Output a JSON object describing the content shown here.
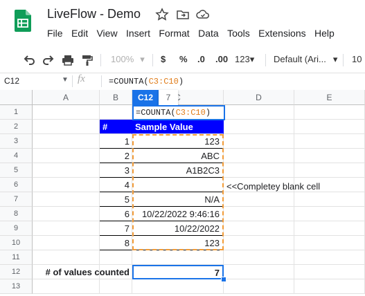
{
  "doc": {
    "title": "LiveFlow - Demo"
  },
  "menu": [
    "File",
    "Edit",
    "View",
    "Insert",
    "Format",
    "Data",
    "Tools",
    "Extensions",
    "Help"
  ],
  "toolbar": {
    "zoom": "100%",
    "currency": "$",
    "percent": "%",
    "dec_less": ".0",
    "dec_more": ".00",
    "more_formats": "123",
    "font": "Default (Ari...",
    "font_size": "10"
  },
  "formula_bar": {
    "cell_ref": "C12",
    "fx": "fx",
    "formula_prefix": "=COUNTA(",
    "formula_ref": "C3:C10",
    "formula_suffix": ")"
  },
  "columns": [
    "A",
    "B",
    "C",
    "D",
    "E"
  ],
  "rows": [
    "1",
    "2",
    "3",
    "4",
    "5",
    "6",
    "7",
    "8",
    "9",
    "10",
    "11",
    "12",
    "13"
  ],
  "table": {
    "header_num": "#",
    "header_value": "Sample Value",
    "nums": [
      "1",
      "2",
      "3",
      "4",
      "5",
      "6",
      "7",
      "8"
    ],
    "values": [
      "123",
      "ABC",
      "A1B2C3",
      "",
      "N/A",
      "10/22/2022 9:46:16",
      "10/22/2022",
      "123"
    ]
  },
  "annotation": "<<Completey blank cell",
  "result": {
    "label": "# of values counted",
    "value": "7"
  },
  "edit_popup": {
    "cell_tag": "C12",
    "preview": "7",
    "formula_prefix": "=COUNTA(",
    "formula_ref": "C3:C10",
    "formula_suffix": ")"
  }
}
